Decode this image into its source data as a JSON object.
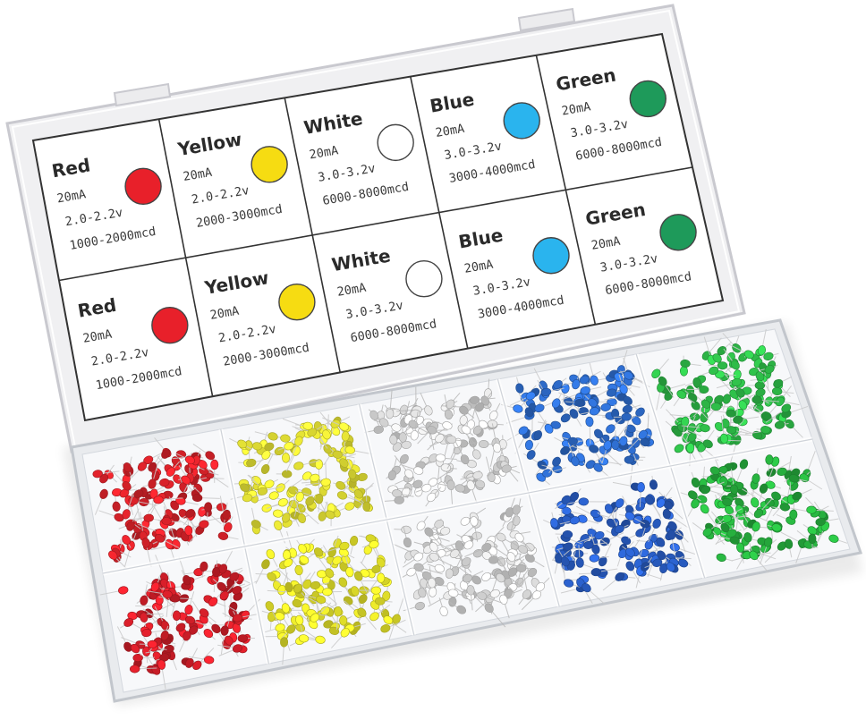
{
  "product": {
    "description_hidden": "",
    "label_sheet": {
      "cells": [
        {
          "color_name": "Red",
          "current": "20mA",
          "voltage": "2.0-2.2v",
          "brightness": "1000-2000mcd",
          "swatch": "#e8202a"
        },
        {
          "color_name": "Yellow",
          "current": "20mA",
          "voltage": "2.0-2.2v",
          "brightness": "2000-3000mcd",
          "swatch": "#f6dc12"
        },
        {
          "color_name": "White",
          "current": "20mA",
          "voltage": "3.0-3.2v",
          "brightness": "6000-8000mcd",
          "swatch": "#ffffff"
        },
        {
          "color_name": "Blue",
          "current": "20mA",
          "voltage": "3.0-3.2v",
          "brightness": "3000-4000mcd",
          "swatch": "#2ab4ee"
        },
        {
          "color_name": "Green",
          "current": "20mA",
          "voltage": "3.0-3.2v",
          "brightness": "6000-8000mcd",
          "swatch": "#1e9a5a"
        },
        {
          "color_name": "Red",
          "current": "20mA",
          "voltage": "2.0-2.2v",
          "brightness": "1000-2000mcd",
          "swatch": "#e8202a"
        },
        {
          "color_name": "Yellow",
          "current": "20mA",
          "voltage": "2.0-2.2v",
          "brightness": "2000-3000mcd",
          "swatch": "#f6dc12"
        },
        {
          "color_name": "White",
          "current": "20mA",
          "voltage": "3.0-3.2v",
          "brightness": "6000-8000mcd",
          "swatch": "#ffffff"
        },
        {
          "color_name": "Blue",
          "current": "20mA",
          "voltage": "3.0-3.2v",
          "brightness": "3000-4000mcd",
          "swatch": "#2ab4ee"
        },
        {
          "color_name": "Green",
          "current": "20mA",
          "voltage": "3.0-3.2v",
          "brightness": "6000-8000mcd",
          "swatch": "#1e9a5a"
        }
      ]
    },
    "compartments": [
      {
        "led_color": "#e0232b",
        "lead_color": "#c9c9c9"
      },
      {
        "led_color": "#f2ef38",
        "lead_color": "#c9c9c9"
      },
      {
        "led_color": "#e4e4e4",
        "lead_color": "#b9b9b9"
      },
      {
        "led_color": "#2f6fd2",
        "lead_color": "#c9c9c9"
      },
      {
        "led_color": "#2fc04a",
        "lead_color": "#c9c9c9"
      },
      {
        "led_color": "#d81f2a",
        "lead_color": "#c9c9c9"
      },
      {
        "led_color": "#eeec2c",
        "lead_color": "#c9c9c9"
      },
      {
        "led_color": "#e6e6e6",
        "lead_color": "#b9b9b9"
      },
      {
        "led_color": "#2a5fc8",
        "lead_color": "#c9c9c9"
      },
      {
        "led_color": "#28b440",
        "lead_color": "#c9c9c9"
      }
    ]
  }
}
